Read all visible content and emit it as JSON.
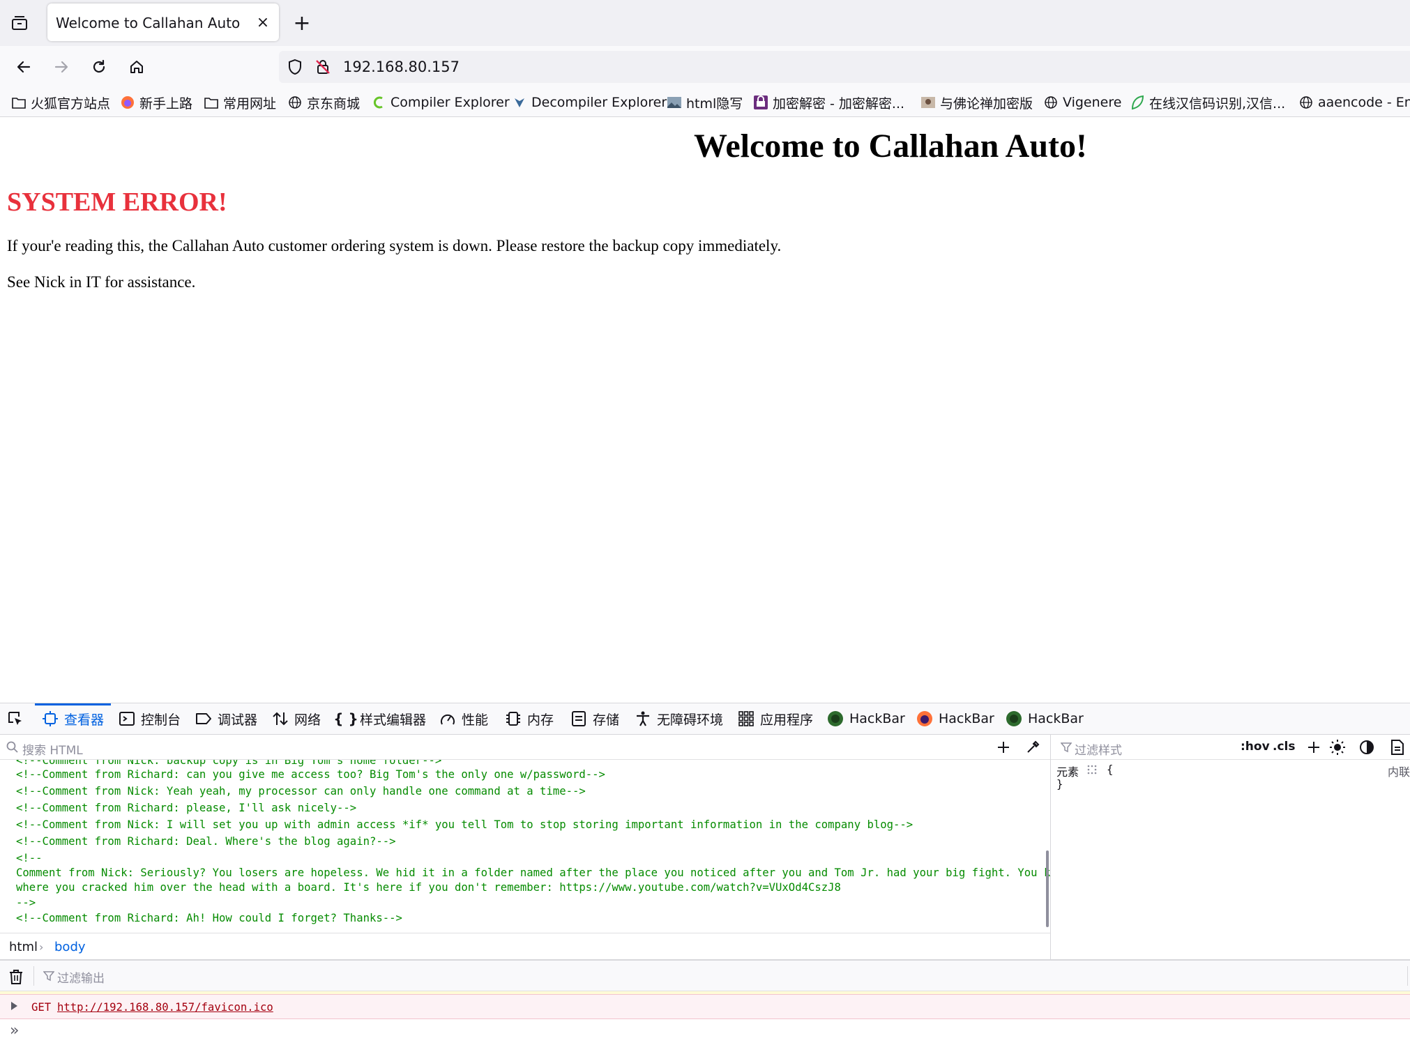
{
  "browser": {
    "tab_title": "Welcome to Callahan Auto",
    "tab_close": "×",
    "new_tab": "+",
    "url": "192.168.80.157"
  },
  "bookmarks": [
    {
      "label": "火狐官方站点",
      "icon": "folder-icon"
    },
    {
      "label": "新手上路",
      "icon": "firefox-icon"
    },
    {
      "label": "常用网址",
      "icon": "folder-icon"
    },
    {
      "label": "京东商城",
      "icon": "globe-icon"
    },
    {
      "label": "Compiler Explorer",
      "icon": "compiler-explorer-icon"
    },
    {
      "label": "Decompiler Explorer",
      "icon": "dragon-icon"
    },
    {
      "label": "html隐写",
      "icon": "image-icon"
    },
    {
      "label": "加密解密 - 加密解密...",
      "icon": "lock-app-icon"
    },
    {
      "label": "与佛论禅加密版",
      "icon": "image-icon"
    },
    {
      "label": "Vigenere",
      "icon": "globe-icon"
    },
    {
      "label": "在线汉信码识别,汉信...",
      "icon": "leaf-icon"
    },
    {
      "label": "aaencode - Enc",
      "icon": "globe-icon"
    }
  ],
  "page": {
    "title": "Welcome to Callahan Auto!",
    "error_heading": "SYSTEM ERROR!",
    "paragraph1": "If your'e reading this, the Callahan Auto customer ordering system is down. Please restore the backup copy immediately.",
    "paragraph2": "See Nick in IT for assistance."
  },
  "colors": {
    "error_red": "#e8313c",
    "accent_blue": "#0061e0",
    "comment_green": "#058b00",
    "console_error_text": "#a4000f"
  },
  "devtools": {
    "tabs": [
      {
        "label": "查看器",
        "icon": "inspector-icon",
        "active": true
      },
      {
        "label": "控制台",
        "icon": "console-icon",
        "active": false
      },
      {
        "label": "调试器",
        "icon": "debugger-icon",
        "active": false
      },
      {
        "label": "网络",
        "icon": "network-icon",
        "active": false
      },
      {
        "label": "样式编辑器",
        "icon": "braces-icon",
        "active": false
      },
      {
        "label": "性能",
        "icon": "gauge-icon",
        "active": false
      },
      {
        "label": "内存",
        "icon": "memory-icon",
        "active": false
      },
      {
        "label": "存储",
        "icon": "storage-icon",
        "active": false
      },
      {
        "label": "无障碍环境",
        "icon": "accessibility-icon",
        "active": false
      },
      {
        "label": "应用程序",
        "icon": "grid-icon",
        "active": false
      },
      {
        "label": "HackBar",
        "icon": "hackbar-green-icon",
        "active": false
      },
      {
        "label": "HackBar",
        "icon": "hackbar-fox-icon",
        "active": false
      },
      {
        "label": "HackBar",
        "icon": "hackbar-green-icon",
        "active": false
      }
    ],
    "search_placeholder": "搜索 HTML",
    "markup_lines": [
      "<!--Comment from Nick: backup copy is in Big Tom's home folder-->",
      "<!--Comment from Richard: can you give me access too? Big Tom's the only one w/password-->",
      "<!--Comment from Nick: Yeah yeah, my processor can only handle one command at a time-->",
      "<!--Comment from Richard: please, I'll ask nicely-->",
      "<!--Comment from Nick: I will set you up with admin access *if* you tell Tom to stop storing important information in the company blog-->",
      "<!--Comment from Richard: Deal. Where's the blog again?-->",
      "<!--",
      "Comment from Nick: Seriously? You losers are hopeless. We hid it in a folder named after the place you noticed after you and Tom Jr. had your big fight. You know,",
      "where you cracked him over the head with a board. It's here if you don't remember: https://www.youtube.com/watch?v=VUxOd4CszJ8",
      "-->",
      "<!--Comment from Richard: Ah! How could I forget? Thanks-->"
    ],
    "breadcrumbs": [
      "html",
      "body"
    ],
    "rules": {
      "filter_placeholder": "过滤样式",
      "hov": ":hov",
      "cls": ".cls",
      "selector": "元素",
      "open_brace": "{",
      "close_brace": "}",
      "inline_label": "内联"
    },
    "console": {
      "filter_placeholder": "过滤输出",
      "method": "GET",
      "url": "http://192.168.80.157/favicon.ico",
      "prompt": "»"
    }
  }
}
